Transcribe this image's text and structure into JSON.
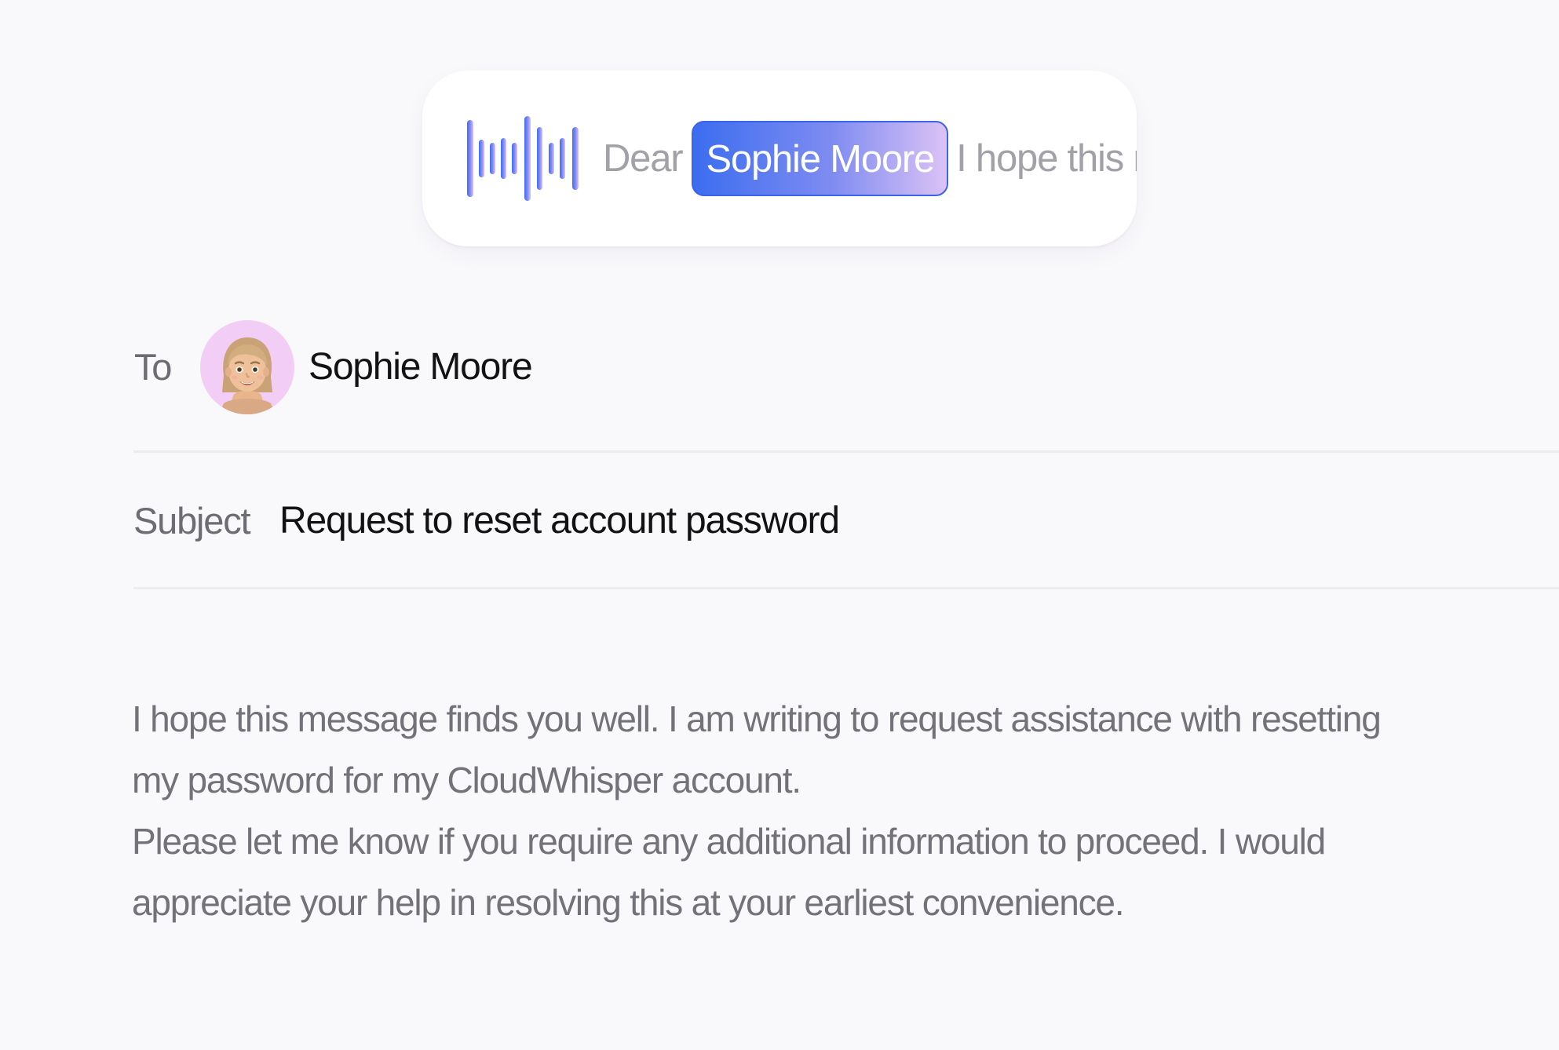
{
  "dictation": {
    "greeting": "Dear",
    "highlighted_name": "Sophie Moore",
    "continuation": "I hope this m",
    "icon": "waveform-icon",
    "colors": {
      "chip_start": "#3b6df0",
      "chip_end": "#dcc2f5",
      "wave_start": "#3b6df0",
      "wave_end": "#d7c4f7"
    }
  },
  "to": {
    "label": "To",
    "recipient_name": "Sophie Moore",
    "avatar": "memoji-avatar"
  },
  "subject": {
    "label": "Subject",
    "value": "Request to reset account password"
  },
  "body": {
    "paragraph_1": "I hope this message finds you well. I am writing to request assistance with resetting my password for my CloudWhisper account.",
    "paragraph_2": "Please let me know if you require any additional information to proceed. I would appreciate your help in resolving this at your earliest convenience."
  }
}
